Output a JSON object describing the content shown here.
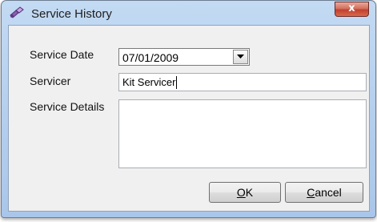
{
  "window": {
    "title": "Service History",
    "close_glyph": "x"
  },
  "form": {
    "service_date_label": "Service Date",
    "service_date_value": "07/01/2009",
    "servicer_label": "Servicer",
    "servicer_value": "Kit Servicer",
    "service_details_label": "Service Details",
    "service_details_value": ""
  },
  "buttons": {
    "ok_mnemonic": "O",
    "ok_rest": "K",
    "cancel_mnemonic": "C",
    "cancel_rest": "ancel"
  },
  "icons": {
    "title_icon": "service-tool-icon",
    "dropdown_icon": "chevron-down-icon"
  }
}
